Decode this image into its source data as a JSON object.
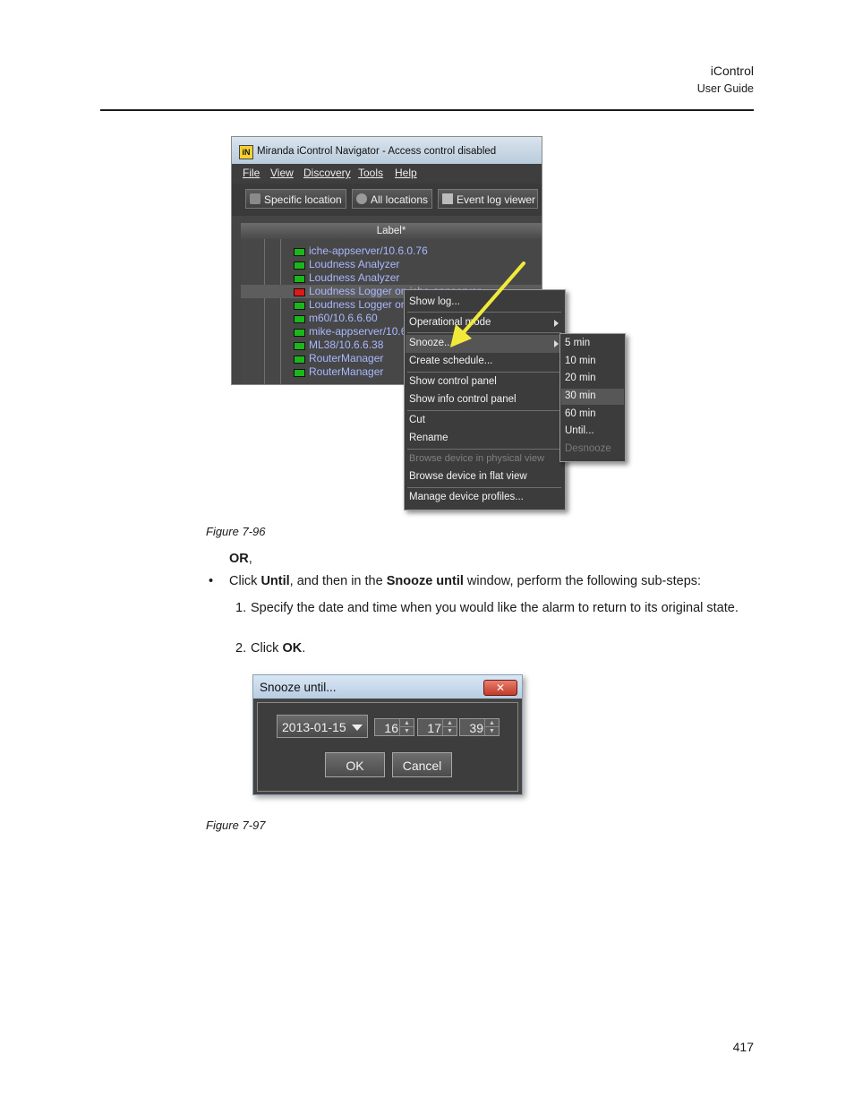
{
  "header": {
    "title": "iControl",
    "subtitle": "User Guide"
  },
  "figure1": {
    "window_title": "Miranda iControl Navigator - Access control disabled",
    "app_icon": "iN",
    "menubar": [
      "File",
      "View",
      "Discovery",
      "Tools",
      "Help"
    ],
    "toolbar": [
      "Specific location",
      "All locations",
      "Event log viewer"
    ],
    "tree_header": "Label*",
    "tree_rows": [
      {
        "label": "iche-appserver/10.6.0.76",
        "status": "green"
      },
      {
        "label": "Loudness Analyzer",
        "status": "green"
      },
      {
        "label": "Loudness Analyzer",
        "status": "green"
      },
      {
        "label": "Loudness Logger on iche-appserver",
        "status": "red"
      },
      {
        "label": "Loudness Logger on",
        "status": "green"
      },
      {
        "label": "m60/10.6.6.60",
        "status": "green"
      },
      {
        "label": "mike-appserver/10.6",
        "status": "green"
      },
      {
        "label": "ML38/10.6.6.38",
        "status": "green"
      },
      {
        "label": "RouterManager",
        "status": "green"
      },
      {
        "label": "RouterManager",
        "status": "green"
      }
    ],
    "context_menu": {
      "show_log": "Show log...",
      "operational_mode": "Operational mode",
      "snooze": "Snooze...",
      "create_schedule": "Create schedule...",
      "show_control_panel": "Show control panel",
      "show_info_control_panel": "Show info control panel",
      "cut": "Cut",
      "rename": "Rename",
      "browse_physical": "Browse device in physical view",
      "browse_flat": "Browse device in flat view",
      "manage_profiles": "Manage device profiles..."
    },
    "snooze_submenu": [
      "5 min",
      "10 min",
      "20 min",
      "30 min",
      "60 min",
      "Until...",
      "Desnooze"
    ],
    "caption": "Figure 7-96"
  },
  "text": {
    "or": "OR",
    "or_comma": ",",
    "bullet_pre": "Click ",
    "bullet_until": "Until",
    "bullet_mid": ", and then in the ",
    "bullet_snooze_until": "Snooze until",
    "bullet_post": " window, perform the following sub-steps:",
    "step1_num": "1.",
    "step1": "Specify the date and time when you would like the alarm to return to its original state.",
    "step2_num": "2.",
    "step2_pre": "Click ",
    "step2_ok": "OK",
    "step2_post": "."
  },
  "figure2": {
    "title": "Snooze until...",
    "close": "✕",
    "date": "2013-01-15",
    "hour": "16",
    "minute": "17",
    "second": "39",
    "ok": "OK",
    "cancel": "Cancel",
    "caption": "Figure 7-97"
  },
  "page_number": "417",
  "colors": {
    "status_green": "#1bb61b",
    "status_red": "#e01818",
    "arrow": "#f2ea3a",
    "tree_text": "#a9b8ff"
  }
}
